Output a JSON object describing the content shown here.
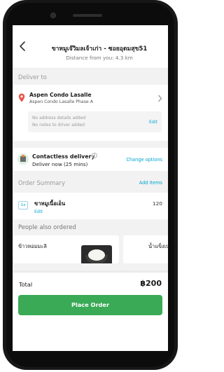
{
  "header": {
    "title": "ขาหมูเจ๊วิมลเจ้าเก่า - ซอยอุดมสุข51",
    "distance": "Distance from you: 4.3 km"
  },
  "deliver": {
    "section_label": "Deliver to",
    "address_name": "Aspen Condo Lasalle",
    "address_detail": "Aspen Condo Lasalle Phase A",
    "no_address_details": "No address details added",
    "no_notes": "No notes to driver added",
    "edit_label": "Edit"
  },
  "contactless": {
    "title": "Contactless delivery",
    "eta": "Deliver now (25 mins)",
    "change_label": "Change options"
  },
  "order": {
    "section_label": "Order Summary",
    "add_items_label": "Add Items",
    "items": [
      {
        "qty": "1x",
        "name": "ขาหมูเนื้อเอ็น",
        "price": "120",
        "edit": "Edit"
      }
    ]
  },
  "recommendations": {
    "label": "People also ordered",
    "items": [
      {
        "name": "ข้าวหอมมะลิ"
      },
      {
        "name": "น้ำแข็งเปล่า"
      }
    ]
  },
  "footer": {
    "total_label": "Total",
    "total_value": "฿200",
    "place_order_label": "Place Order"
  },
  "colors": {
    "accent": "#00a5cf",
    "primary_button": "#3aaa56",
    "pin": "#e8554e"
  }
}
